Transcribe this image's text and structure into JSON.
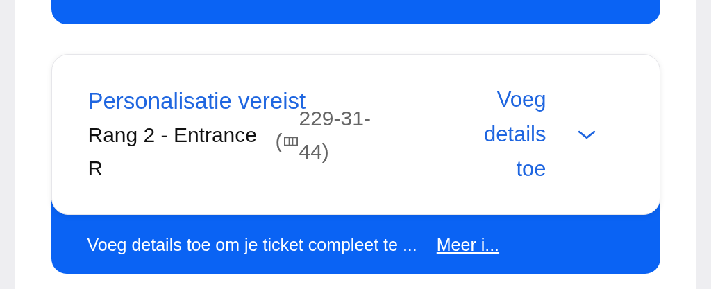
{
  "ticket_card": {
    "title": "Personalisatie vereist",
    "seat": "Rang 2 - Entrance R",
    "ticket_prefix": "(",
    "ticket_number": "229-31-44)",
    "action": "Voeg details toe",
    "expanded": false
  },
  "banner": {
    "message": "Voeg details toe om je ticket compleet te ...",
    "link": "Meer i..."
  }
}
